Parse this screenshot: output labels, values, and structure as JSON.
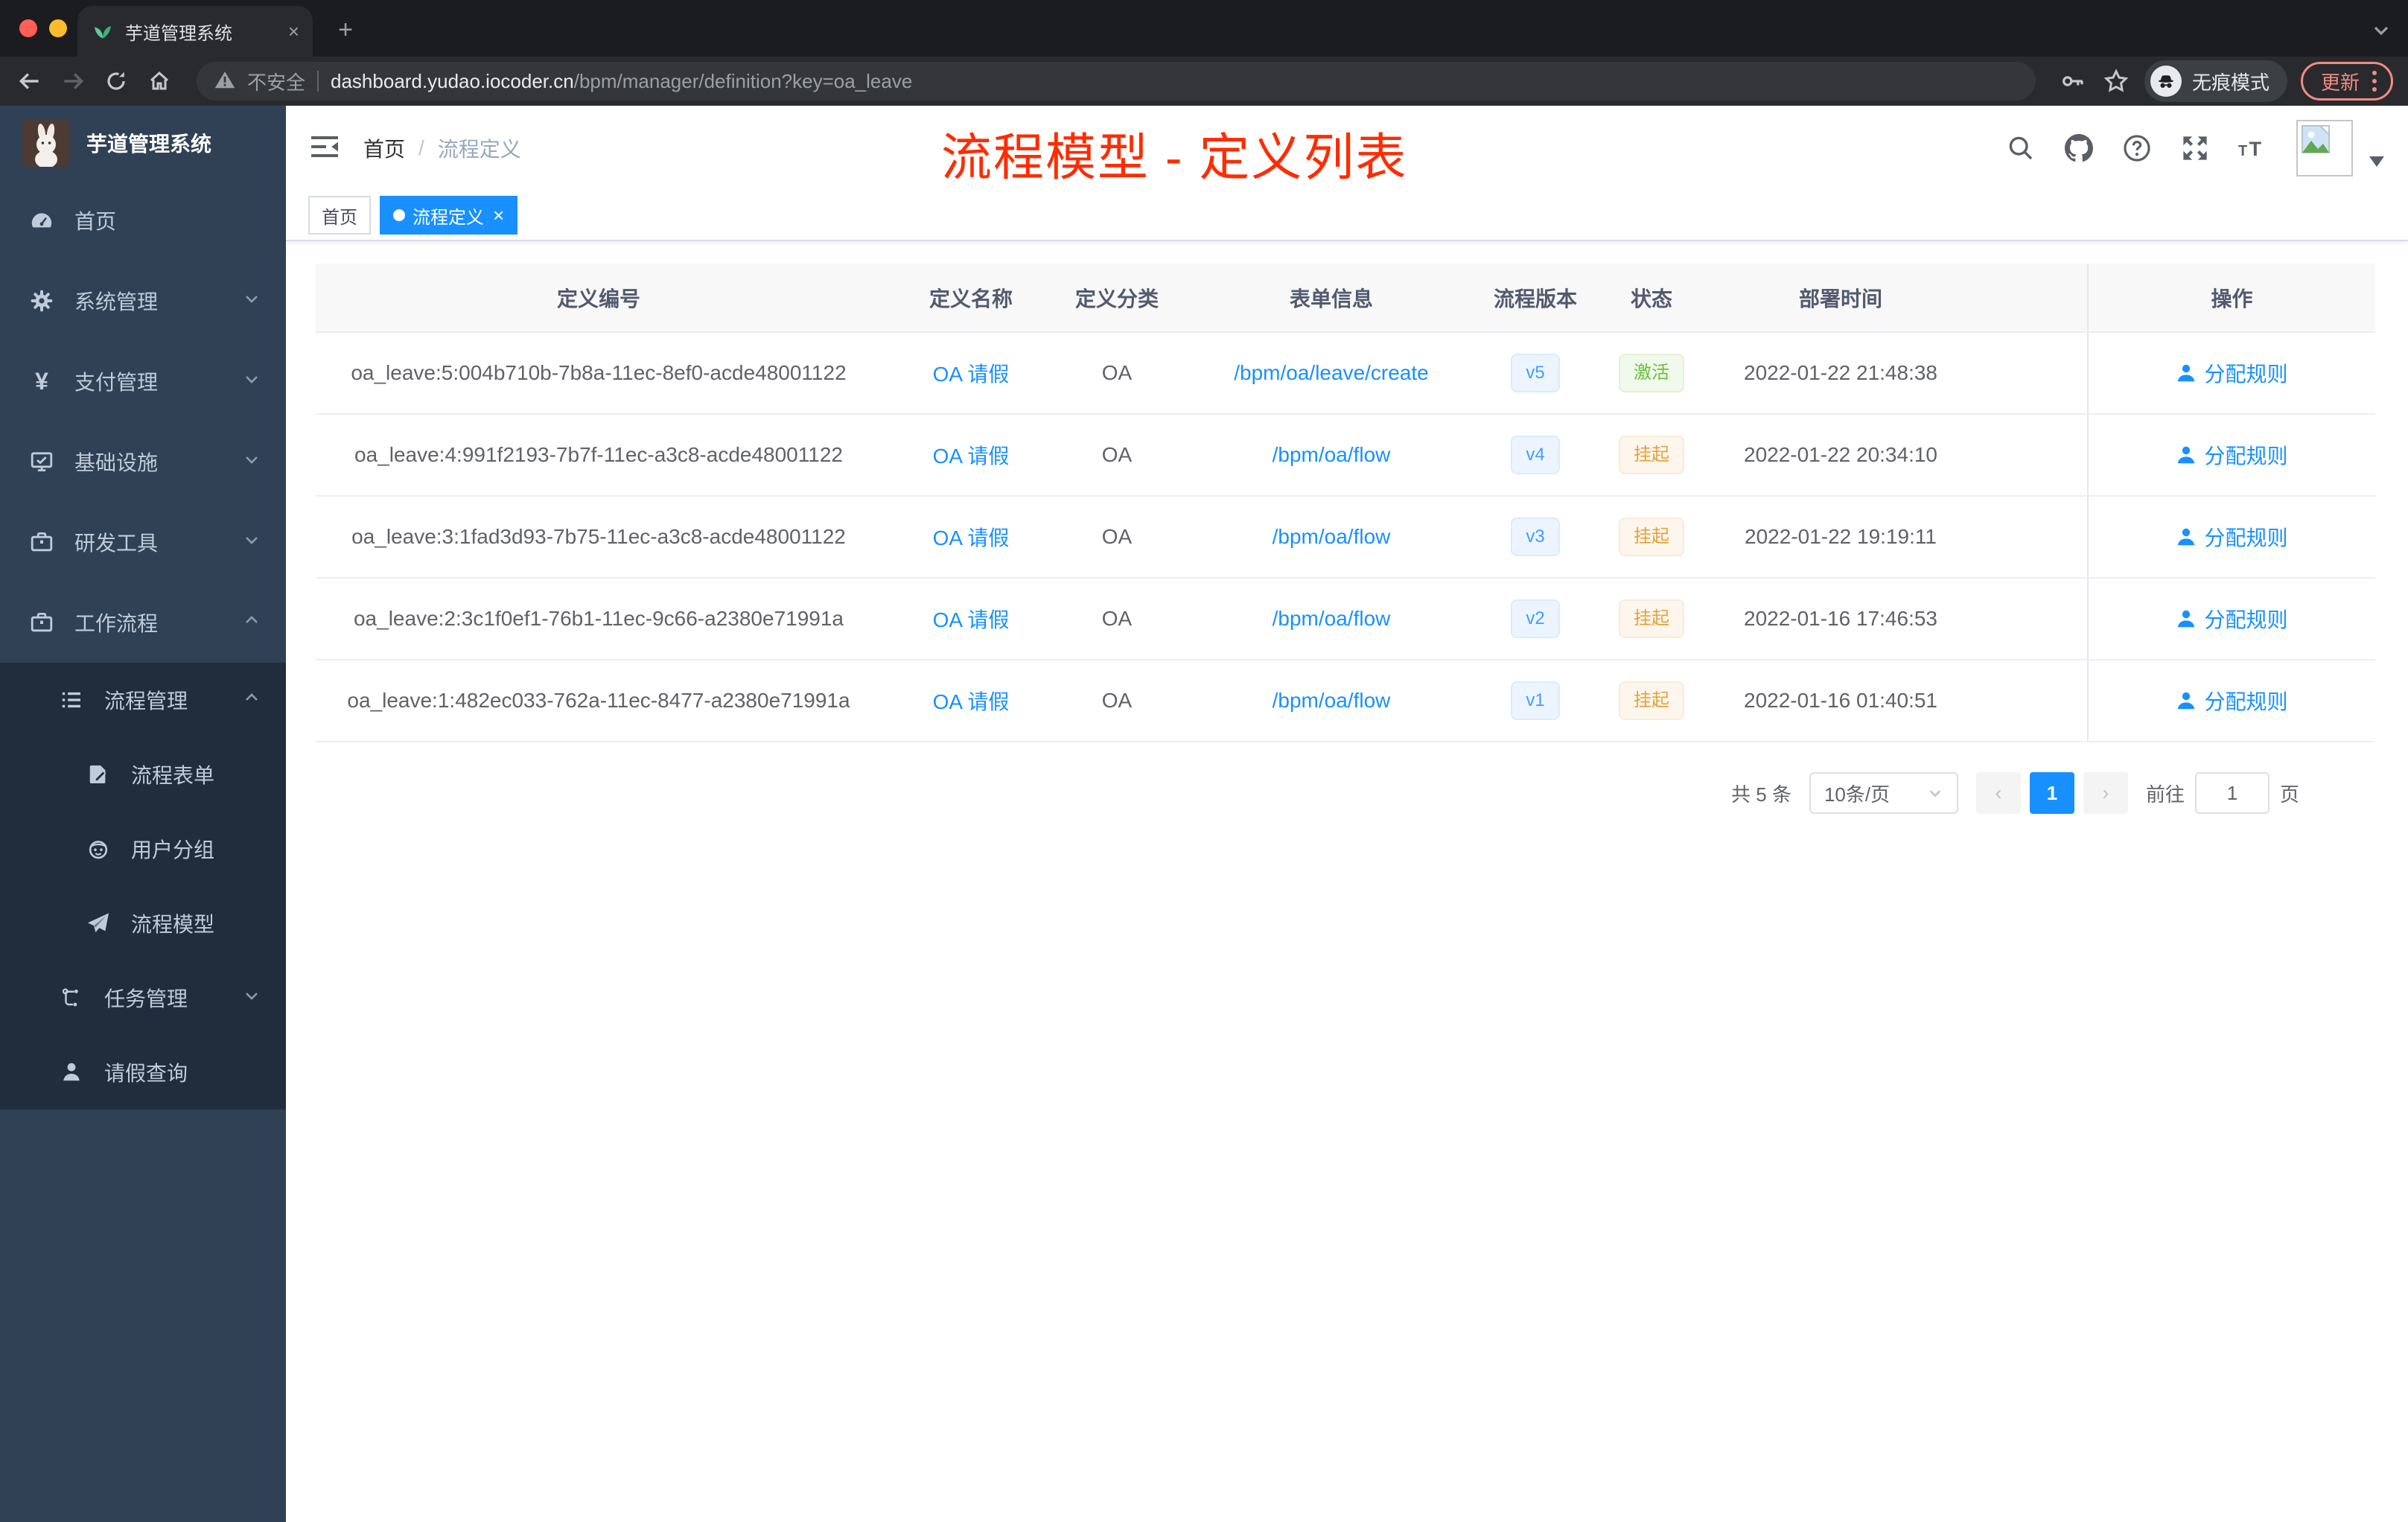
{
  "browser": {
    "tab_title": "芋道管理系统",
    "new_tab_glyph": "+",
    "close_glyph": "×",
    "security_label": "不安全",
    "url_host": "dashboard.yudao.iocoder.cn",
    "url_path": "/bpm/manager/definition?key=oa_leave",
    "incognito_label": "无痕模式",
    "update_label": "更新"
  },
  "sidebar": {
    "app_title": "芋道管理系统",
    "items": [
      {
        "label": "首页"
      },
      {
        "label": "系统管理"
      },
      {
        "label": "支付管理"
      },
      {
        "label": "基础设施"
      },
      {
        "label": "研发工具"
      },
      {
        "label": "工作流程"
      },
      {
        "label": "流程管理"
      },
      {
        "label": "流程表单"
      },
      {
        "label": "用户分组"
      },
      {
        "label": "流程模型"
      },
      {
        "label": "任务管理"
      },
      {
        "label": "请假查询"
      }
    ]
  },
  "header": {
    "breadcrumb_home": "首页",
    "breadcrumb_separator": "/",
    "breadcrumb_current": "流程定义",
    "annotation": "流程模型 - 定义列表",
    "annotation_color": "#fe2c00"
  },
  "tags_view": {
    "close_glyph": "×",
    "tags": [
      {
        "label": "首页",
        "active": false
      },
      {
        "label": "流程定义",
        "active": true
      }
    ]
  },
  "table": {
    "columns": [
      "定义编号",
      "定义名称",
      "定义分类",
      "表单信息",
      "流程版本",
      "状态",
      "部署时间",
      "操作"
    ],
    "rows": [
      {
        "id": "oa_leave:5:004b710b-7b8a-11ec-8ef0-acde48001122",
        "name": "OA 请假",
        "category": "OA",
        "form": "/bpm/oa/leave/create",
        "version": "v5",
        "status": "激活",
        "status_type": "success",
        "deploy_time": "2022-01-22 21:48:38",
        "action": "分配规则"
      },
      {
        "id": "oa_leave:4:991f2193-7b7f-11ec-a3c8-acde48001122",
        "name": "OA 请假",
        "category": "OA",
        "form": "/bpm/oa/flow",
        "version": "v4",
        "status": "挂起",
        "status_type": "warning",
        "deploy_time": "2022-01-22 20:34:10",
        "action": "分配规则"
      },
      {
        "id": "oa_leave:3:1fad3d93-7b75-11ec-a3c8-acde48001122",
        "name": "OA 请假",
        "category": "OA",
        "form": "/bpm/oa/flow",
        "version": "v3",
        "status": "挂起",
        "status_type": "warning",
        "deploy_time": "2022-01-22 19:19:11",
        "action": "分配规则"
      },
      {
        "id": "oa_leave:2:3c1f0ef1-76b1-11ec-9c66-a2380e71991a",
        "name": "OA 请假",
        "category": "OA",
        "form": "/bpm/oa/flow",
        "version": "v2",
        "status": "挂起",
        "status_type": "warning",
        "deploy_time": "2022-01-16 17:46:53",
        "action": "分配规则"
      },
      {
        "id": "oa_leave:1:482ec033-762a-11ec-8477-a2380e71991a",
        "name": "OA 请假",
        "category": "OA",
        "form": "/bpm/oa/flow",
        "version": "v1",
        "status": "挂起",
        "status_type": "warning",
        "deploy_time": "2022-01-16 01:40:51",
        "action": "分配规则"
      }
    ]
  },
  "pagination": {
    "total_label": "共 5 条",
    "page_size_label": "10条/页",
    "prev_glyph": "‹",
    "current_page": "1",
    "next_glyph": "›",
    "goto_label": "前往",
    "goto_value": "1",
    "page_unit_label": "页"
  },
  "colors": {
    "accent_blue": "#1890ff",
    "version_tag_blue": "#409eff",
    "success_green": "#67c23a",
    "warning_orange": "#e6a23c",
    "annotation_red": "#fe2c00",
    "sidebar_bg": "#304156",
    "sidebar_submenu_bg": "#1f2d3d",
    "update_pill_red": "#f28b82",
    "tab_active_blue": "#1890ff"
  },
  "icons": {
    "tab_favicon": "leaf",
    "url_security": "warning-triangle",
    "browser_nav": [
      "back-arrow",
      "forward-arrow",
      "reload",
      "home"
    ],
    "omnibox_right": [
      "key",
      "star"
    ],
    "incognito_badge": "incognito-hat-glasses",
    "navbar_right": [
      "search",
      "github",
      "question",
      "fullscreen",
      "font-size",
      "avatar-placeholder",
      "caret-down"
    ],
    "sidebar_icons": [
      "dashboard",
      "gear",
      "yen",
      "monitor",
      "briefcase",
      "briefcase",
      "list",
      "form-pen",
      "robot",
      "paper-plane",
      "tree",
      "user"
    ],
    "row_action_icon": "user"
  }
}
